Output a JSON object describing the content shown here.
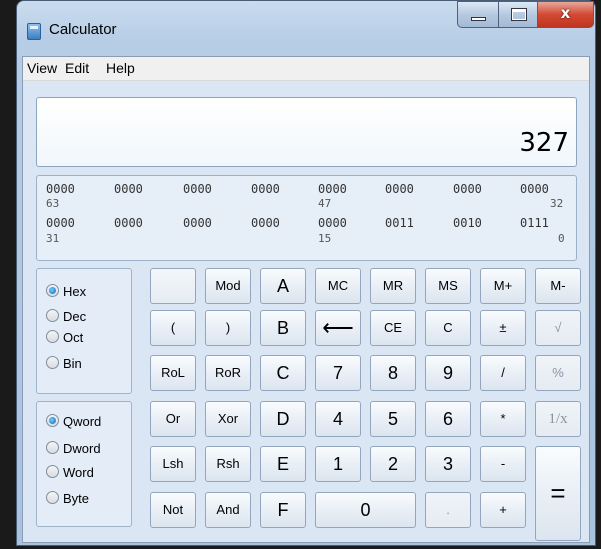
{
  "window": {
    "title": "Calculator",
    "close_glyph": "x",
    "icon": "calculator-icon"
  },
  "menu": [
    "View",
    "Edit",
    "Help"
  ],
  "display": {
    "value": "327"
  },
  "bits": {
    "row1": [
      "0000",
      "0000",
      "0000",
      "0000",
      "0000",
      "0000",
      "0000",
      "0000"
    ],
    "row1_pos": [
      "63",
      "47",
      "32"
    ],
    "row2": [
      "0000",
      "0000",
      "0000",
      "0000",
      "0000",
      "0011",
      "0010",
      "0111"
    ],
    "row2_pos": [
      "31",
      "15",
      "0"
    ]
  },
  "base_options": [
    {
      "label": "Hex",
      "selected": true
    },
    {
      "label": "Dec",
      "selected": false
    },
    {
      "label": "Oct",
      "selected": false
    },
    {
      "label": "Bin",
      "selected": false
    }
  ],
  "word_options": [
    {
      "label": "Qword",
      "selected": true
    },
    {
      "label": "Dword",
      "selected": false
    },
    {
      "label": "Word",
      "selected": false
    },
    {
      "label": "Byte",
      "selected": false
    }
  ],
  "keys": {
    "blank": "",
    "mod": "Mod",
    "a": "A",
    "mc": "MC",
    "mr": "MR",
    "ms": "MS",
    "mplus": "M+",
    "mminus": "M-",
    "lparen": "(",
    "rparen": ")",
    "b": "B",
    "backspace": "⟵",
    "ce": "CE",
    "c": "C",
    "plusminus": "±",
    "sqrt": "√",
    "rol": "RoL",
    "ror": "RoR",
    "hc": "C",
    "seven": "7",
    "eight": "8",
    "nine": "9",
    "divide": "/",
    "percent": "%",
    "or": "Or",
    "xor": "Xor",
    "d": "D",
    "four": "4",
    "five": "5",
    "six": "6",
    "multiply": "*",
    "reciprocal": "1/x",
    "lsh": "Lsh",
    "rsh": "Rsh",
    "e": "E",
    "one": "1",
    "two": "2",
    "three": "3",
    "minus": "-",
    "equals": "=",
    "not": "Not",
    "and": "And",
    "f": "F",
    "zero": "0",
    "dot": ".",
    "plus": "+"
  }
}
